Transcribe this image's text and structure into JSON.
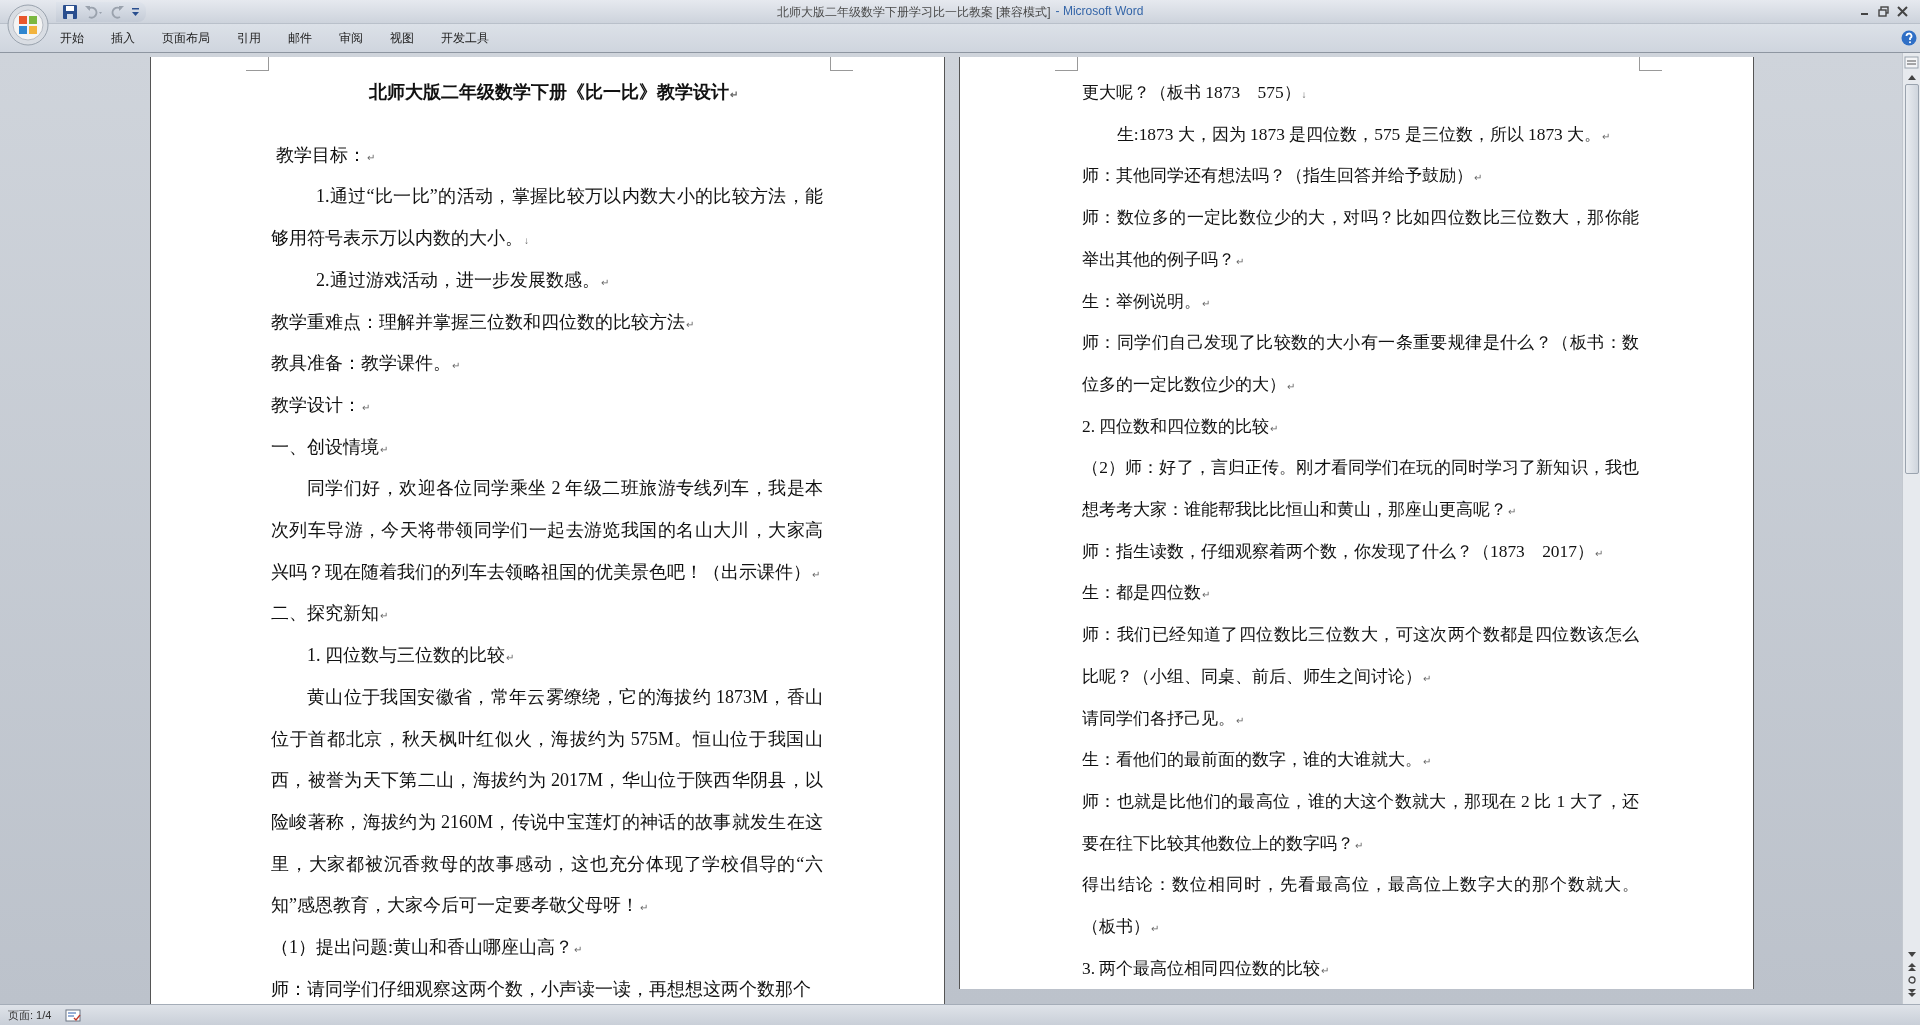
{
  "window": {
    "title": "北师大版二年级数学下册学习比一比教案 [兼容模式]",
    "app_name": "- Microsoft Word"
  },
  "quick_access": [
    {
      "kind": "save",
      "disabled": false
    },
    {
      "kind": "undo",
      "disabled": true
    },
    {
      "kind": "redo",
      "disabled": true
    },
    {
      "kind": "customize",
      "disabled": false
    }
  ],
  "ribbon_tabs": [
    "开始",
    "插入",
    "页面布局",
    "引用",
    "邮件",
    "审阅",
    "视图",
    "开发工具"
  ],
  "pages": [
    {
      "paragraphs": [
        {
          "kind": "title",
          "text": "北师大版二年级数学下册《比一比》教学设计",
          "end_mark": "↵"
        },
        {
          "kind": "lead",
          "text": "教学目标：",
          "end_mark": "↵"
        },
        {
          "kind": "goal",
          "text": "1.通过“比一比”的活动，掌握比较万以内数大小的比较方法，能够用符号表示万以内数的大小。",
          "end_mark": "↓"
        },
        {
          "kind": "goal",
          "text": "2.通过游戏活动，进一步发展数感。",
          "end_mark": "↵"
        },
        {
          "kind": "plain",
          "text": "教学重难点：理解并掌握三位数和四位数的比较方法",
          "end_mark": "↵"
        },
        {
          "kind": "plain",
          "text": "教具准备：教学课件。",
          "end_mark": "↵"
        },
        {
          "kind": "plain",
          "text": "教学设计：",
          "end_mark": "↵"
        },
        {
          "kind": "plain",
          "text": "一、创设情境",
          "end_mark": "↵"
        },
        {
          "kind": "indent",
          "text": "同学们好，欢迎各位同学乘坐 2 年级二班旅游专线列车，我是本次列车导游，今天将带领同学们一起去游览我国的名山大川，大家高兴吗？现在随着我们的列车去领略祖国的优美景色吧！（出示课件）",
          "end_mark": "↵"
        },
        {
          "kind": "plain",
          "text": "二、探究新知",
          "end_mark": "↵"
        },
        {
          "kind": "indent",
          "text": "1. 四位数与三位数的比较",
          "end_mark": "↵"
        },
        {
          "kind": "indent",
          "text": "黄山位于我国安徽省，常年云雾缭绕，它的海拔约 1873M，香山位于首都北京，秋天枫叶红似火，海拔约为 575M。恒山位于我国山西，被誉为天下第二山，海拔约为 2017M，华山位于陕西华阴县，以险峻著称，海拔约为 2160M，传说中宝莲灯的神话的故事就发生在这里，大家都被沉香救母的故事感动，这也充分体现了学校倡导的“六知”感恩教育，大家今后可一定要孝敬父母呀！",
          "end_mark": "↵"
        },
        {
          "kind": "plain",
          "text": "（1）提出问题:黄山和香山哪座山高？",
          "end_mark": "↵"
        },
        {
          "kind": "plain",
          "text": "师：请同学们仔细观察这两个数，小声读一读，再想想这两个数那个"
        }
      ]
    },
    {
      "paragraphs": [
        {
          "kind": "plain",
          "text": "更大呢？（板书 1873    575）",
          "end_mark": "↓"
        },
        {
          "kind": "indent",
          "text": "生:1873 大，因为 1873 是四位数，575 是三位数，所以 1873 大。",
          "end_mark": "↵"
        },
        {
          "kind": "plain",
          "text": "师：其他同学还有想法吗？（指生回答并给予鼓励）",
          "end_mark": "↵"
        },
        {
          "kind": "plain",
          "text": "师：数位多的一定比数位少的大，对吗？比如四位数比三位数大，那你能举出其他的例子吗？",
          "end_mark": "↵"
        },
        {
          "kind": "plain",
          "text": "生：举例说明。",
          "end_mark": "↵"
        },
        {
          "kind": "plain",
          "text": "师：同学们自己发现了比较数的大小有一条重要规律是什么？（板书：数位多的一定比数位少的大）",
          "end_mark": "↵"
        },
        {
          "kind": "plain",
          "text": "2. 四位数和四位数的比较",
          "end_mark": "↵"
        },
        {
          "kind": "plain",
          "text": "（2）师：好了，言归正传。刚才看同学们在玩的同时学习了新知识，我也想考考大家：谁能帮我比比恒山和黄山，那座山更高呢？",
          "end_mark": "↵"
        },
        {
          "kind": "plain",
          "text": "师：指生读数，仔细观察着两个数，你发现了什么？（1873    2017）",
          "end_mark": "↵"
        },
        {
          "kind": "plain",
          "text": "生：都是四位数",
          "end_mark": "↵"
        },
        {
          "kind": "plain",
          "text": "师：我们已经知道了四位数比三位数大，可这次两个数都是四位数该怎么比呢？（小组、同桌、前后、师生之间讨论）",
          "end_mark": "↵"
        },
        {
          "kind": "plain",
          "text": "请同学们各抒己见。",
          "end_mark": "↵"
        },
        {
          "kind": "plain",
          "text": "生：看他们的最前面的数字，谁的大谁就大。",
          "end_mark": "↵"
        },
        {
          "kind": "plain",
          "text": "师：也就是比他们的最高位，谁的大这个数就大，那现在 2 比 1 大了，还要在往下比较其他数位上的数字吗？",
          "end_mark": "↵"
        },
        {
          "kind": "plain",
          "text": "得出结论：数位相同时，先看最高位，最高位上数字大的那个数就大。（板书）",
          "end_mark": "↵"
        },
        {
          "kind": "plain",
          "text": "3. 两个最高位相同四位数的比较",
          "end_mark": "↵"
        }
      ]
    }
  ],
  "status_bar": {
    "page": "页面: 1/4"
  }
}
